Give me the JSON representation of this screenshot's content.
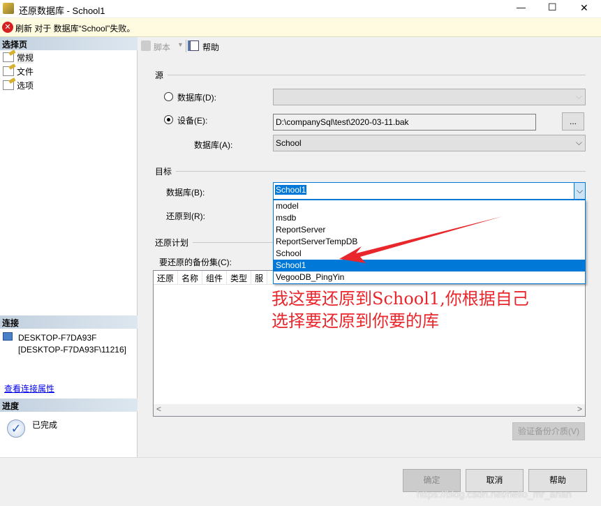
{
  "window": {
    "title": "还原数据库 - School1",
    "minimize": "—",
    "maximize": "☐",
    "close": "✕"
  },
  "error": {
    "message": "刷新 对于 数据库“School”失败。"
  },
  "sidebar": {
    "select_page_header": "选择页",
    "pages": [
      {
        "label": "常规"
      },
      {
        "label": "文件"
      },
      {
        "label": "选项"
      }
    ],
    "connection_header": "连接",
    "server": "DESKTOP-F7DA93F",
    "instance": "[DESKTOP-F7DA93F\\11216]",
    "view_connection_link": "查看连接属性",
    "progress_header": "进度",
    "progress_status": "已完成"
  },
  "toolbar": {
    "script": "脚本",
    "help": "帮助"
  },
  "source": {
    "header": "源",
    "database_label": "数据库(D):",
    "device_label": "设备(E):",
    "device_path": "D:\\companySql\\test\\2020-03-11.bak",
    "browse": "...",
    "db_label": "数据库(A):",
    "db_value": "School",
    "selected_option": "device"
  },
  "target": {
    "header": "目标",
    "database_label": "数据库(B):",
    "database_value": "School1",
    "restore_to_label": "还原到(R):",
    "options": [
      "model",
      "msdb",
      "ReportServer",
      "ReportServerTempDB",
      "School",
      "School1",
      "VegooDB_PingYin"
    ],
    "selected_index": 5
  },
  "plan": {
    "header": "还原计划",
    "backup_sets_label": "要还原的备份集(C):",
    "columns": [
      "还原",
      "名称",
      "组件",
      "类型",
      "服"
    ],
    "verify_button": "验证备份介质(V)"
  },
  "annotation": {
    "line1": "我这要还原到School1,你根据自己",
    "line2": "选择要还原到你要的库",
    "color": "#e8262b"
  },
  "footer": {
    "ok": "确定",
    "cancel": "取消",
    "help": "帮助"
  },
  "watermark": "https://blog.csdn.net/hello_mr_anan"
}
